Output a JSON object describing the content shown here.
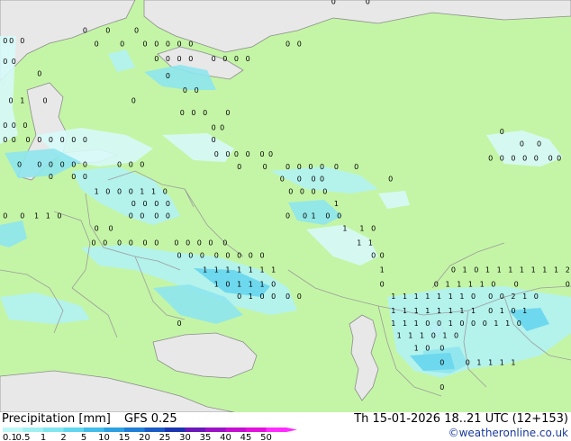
{
  "footer": {
    "title": "Precipitation [mm]",
    "model": "GFS 0.25",
    "valid": "Th 15-01-2026 18..21 UTC (12+153)",
    "credit": "©weatheronline.co.uk"
  },
  "legend": {
    "values": [
      "0.1",
      "0.5",
      "1",
      "2",
      "5",
      "10",
      "15",
      "20",
      "25",
      "30",
      "35",
      "40",
      "45",
      "50"
    ],
    "colors": [
      "#bdf7f7",
      "#9ef0f2",
      "#7fe6ef",
      "#5fd6ee",
      "#42bdea",
      "#2da0e2",
      "#1f7fd6",
      "#1a5ac4",
      "#1b34b0",
      "#6a18b8",
      "#9a12c4",
      "#c40fd0",
      "#e211dc",
      "#ff2bff"
    ]
  },
  "map": {
    "land_color": "#c4f5a6",
    "sea_color": "#e8e8e8",
    "border_color": "#8c8c8c",
    "precip_colors": [
      "#d7fafa",
      "#b2f2f4",
      "#8ee6ee"
    ],
    "markers": [
      {
        "x": 0.005,
        "y": 0.105,
        "t": "0"
      },
      {
        "x": 0.016,
        "y": 0.105,
        "t": "0"
      },
      {
        "x": 0.035,
        "y": 0.105,
        "t": "0"
      },
      {
        "x": 0.005,
        "y": 0.155,
        "t": "0"
      },
      {
        "x": 0.02,
        "y": 0.155,
        "t": "0"
      },
      {
        "x": 0.145,
        "y": 0.08,
        "t": "0"
      },
      {
        "x": 0.185,
        "y": 0.08,
        "t": "0"
      },
      {
        "x": 0.235,
        "y": 0.08,
        "t": "0"
      },
      {
        "x": 0.165,
        "y": 0.112,
        "t": "0"
      },
      {
        "x": 0.21,
        "y": 0.112,
        "t": "0"
      },
      {
        "x": 0.25,
        "y": 0.112,
        "t": "0"
      },
      {
        "x": 0.27,
        "y": 0.112,
        "t": "0"
      },
      {
        "x": 0.29,
        "y": 0.112,
        "t": "0"
      },
      {
        "x": 0.31,
        "y": 0.112,
        "t": "0"
      },
      {
        "x": 0.33,
        "y": 0.112,
        "t": "0"
      },
      {
        "x": 0.27,
        "y": 0.148,
        "t": "0"
      },
      {
        "x": 0.29,
        "y": 0.148,
        "t": "0"
      },
      {
        "x": 0.31,
        "y": 0.148,
        "t": "0"
      },
      {
        "x": 0.33,
        "y": 0.148,
        "t": "0"
      },
      {
        "x": 0.37,
        "y": 0.148,
        "t": "0"
      },
      {
        "x": 0.39,
        "y": 0.148,
        "t": "0"
      },
      {
        "x": 0.41,
        "y": 0.148,
        "t": "0"
      },
      {
        "x": 0.43,
        "y": 0.148,
        "t": "0"
      },
      {
        "x": 0.5,
        "y": 0.112,
        "t": "0"
      },
      {
        "x": 0.52,
        "y": 0.112,
        "t": "0"
      },
      {
        "x": 0.065,
        "y": 0.185,
        "t": "0"
      },
      {
        "x": 0.29,
        "y": 0.19,
        "t": "0"
      },
      {
        "x": 0.015,
        "y": 0.25,
        "t": "0"
      },
      {
        "x": 0.035,
        "y": 0.25,
        "t": "1"
      },
      {
        "x": 0.075,
        "y": 0.25,
        "t": "0"
      },
      {
        "x": 0.23,
        "y": 0.25,
        "t": "0"
      },
      {
        "x": 0.32,
        "y": 0.225,
        "t": "0"
      },
      {
        "x": 0.34,
        "y": 0.225,
        "t": "0"
      },
      {
        "x": 0.315,
        "y": 0.28,
        "t": "0"
      },
      {
        "x": 0.335,
        "y": 0.28,
        "t": "0"
      },
      {
        "x": 0.355,
        "y": 0.28,
        "t": "0"
      },
      {
        "x": 0.395,
        "y": 0.28,
        "t": "0"
      },
      {
        "x": 0.005,
        "y": 0.31,
        "t": "0"
      },
      {
        "x": 0.02,
        "y": 0.31,
        "t": "0"
      },
      {
        "x": 0.04,
        "y": 0.31,
        "t": "0"
      },
      {
        "x": 0.005,
        "y": 0.345,
        "t": "0"
      },
      {
        "x": 0.02,
        "y": 0.345,
        "t": "0"
      },
      {
        "x": 0.045,
        "y": 0.345,
        "t": "0"
      },
      {
        "x": 0.065,
        "y": 0.345,
        "t": "0"
      },
      {
        "x": 0.085,
        "y": 0.345,
        "t": "0"
      },
      {
        "x": 0.105,
        "y": 0.345,
        "t": "0"
      },
      {
        "x": 0.125,
        "y": 0.345,
        "t": "0"
      },
      {
        "x": 0.145,
        "y": 0.345,
        "t": "0"
      },
      {
        "x": 0.37,
        "y": 0.315,
        "t": "0"
      },
      {
        "x": 0.385,
        "y": 0.315,
        "t": "0"
      },
      {
        "x": 0.37,
        "y": 0.345,
        "t": "0"
      },
      {
        "x": 0.375,
        "y": 0.38,
        "t": "0"
      },
      {
        "x": 0.395,
        "y": 0.38,
        "t": "0"
      },
      {
        "x": 0.41,
        "y": 0.38,
        "t": "0"
      },
      {
        "x": 0.43,
        "y": 0.38,
        "t": "0"
      },
      {
        "x": 0.455,
        "y": 0.38,
        "t": "0"
      },
      {
        "x": 0.47,
        "y": 0.38,
        "t": "0"
      },
      {
        "x": 0.415,
        "y": 0.41,
        "t": "0"
      },
      {
        "x": 0.46,
        "y": 0.41,
        "t": "0"
      },
      {
        "x": 0.5,
        "y": 0.41,
        "t": "0"
      },
      {
        "x": 0.52,
        "y": 0.41,
        "t": "0"
      },
      {
        "x": 0.54,
        "y": 0.41,
        "t": "0"
      },
      {
        "x": 0.56,
        "y": 0.41,
        "t": "0"
      },
      {
        "x": 0.585,
        "y": 0.41,
        "t": "0"
      },
      {
        "x": 0.49,
        "y": 0.44,
        "t": "0"
      },
      {
        "x": 0.52,
        "y": 0.44,
        "t": "0"
      },
      {
        "x": 0.545,
        "y": 0.44,
        "t": "0"
      },
      {
        "x": 0.56,
        "y": 0.44,
        "t": "0"
      },
      {
        "x": 0.62,
        "y": 0.41,
        "t": "0"
      },
      {
        "x": 0.68,
        "y": 0.44,
        "t": "0"
      },
      {
        "x": 0.03,
        "y": 0.405,
        "t": "0"
      },
      {
        "x": 0.065,
        "y": 0.405,
        "t": "0"
      },
      {
        "x": 0.085,
        "y": 0.405,
        "t": "0"
      },
      {
        "x": 0.105,
        "y": 0.405,
        "t": "0"
      },
      {
        "x": 0.125,
        "y": 0.405,
        "t": "0"
      },
      {
        "x": 0.145,
        "y": 0.405,
        "t": "0"
      },
      {
        "x": 0.205,
        "y": 0.405,
        "t": "0"
      },
      {
        "x": 0.225,
        "y": 0.405,
        "t": "0"
      },
      {
        "x": 0.245,
        "y": 0.405,
        "t": "0"
      },
      {
        "x": 0.085,
        "y": 0.435,
        "t": "0"
      },
      {
        "x": 0.125,
        "y": 0.435,
        "t": "0"
      },
      {
        "x": 0.145,
        "y": 0.435,
        "t": "0"
      },
      {
        "x": 0.165,
        "y": 0.47,
        "t": "1"
      },
      {
        "x": 0.185,
        "y": 0.47,
        "t": "0"
      },
      {
        "x": 0.205,
        "y": 0.47,
        "t": "0"
      },
      {
        "x": 0.225,
        "y": 0.47,
        "t": "0"
      },
      {
        "x": 0.245,
        "y": 0.47,
        "t": "1"
      },
      {
        "x": 0.265,
        "y": 0.47,
        "t": "1"
      },
      {
        "x": 0.285,
        "y": 0.47,
        "t": "0"
      },
      {
        "x": 0.23,
        "y": 0.5,
        "t": "0"
      },
      {
        "x": 0.25,
        "y": 0.5,
        "t": "0"
      },
      {
        "x": 0.27,
        "y": 0.5,
        "t": "0"
      },
      {
        "x": 0.29,
        "y": 0.5,
        "t": "0"
      },
      {
        "x": 0.505,
        "y": 0.47,
        "t": "0"
      },
      {
        "x": 0.525,
        "y": 0.47,
        "t": "0"
      },
      {
        "x": 0.545,
        "y": 0.47,
        "t": "0"
      },
      {
        "x": 0.565,
        "y": 0.47,
        "t": "0"
      },
      {
        "x": 0.585,
        "y": 0.5,
        "t": "1"
      },
      {
        "x": 0.5,
        "y": 0.53,
        "t": "0"
      },
      {
        "x": 0.53,
        "y": 0.53,
        "t": "0"
      },
      {
        "x": 0.545,
        "y": 0.53,
        "t": "1"
      },
      {
        "x": 0.57,
        "y": 0.53,
        "t": "0"
      },
      {
        "x": 0.59,
        "y": 0.53,
        "t": "0"
      },
      {
        "x": 0.005,
        "y": 0.53,
        "t": "0"
      },
      {
        "x": 0.035,
        "y": 0.53,
        "t": "0"
      },
      {
        "x": 0.06,
        "y": 0.53,
        "t": "1"
      },
      {
        "x": 0.08,
        "y": 0.53,
        "t": "1"
      },
      {
        "x": 0.1,
        "y": 0.53,
        "t": "0"
      },
      {
        "x": 0.225,
        "y": 0.53,
        "t": "0"
      },
      {
        "x": 0.245,
        "y": 0.53,
        "t": "0"
      },
      {
        "x": 0.27,
        "y": 0.53,
        "t": "0"
      },
      {
        "x": 0.29,
        "y": 0.53,
        "t": "0"
      },
      {
        "x": 0.6,
        "y": 0.56,
        "t": "1"
      },
      {
        "x": 0.63,
        "y": 0.56,
        "t": "1"
      },
      {
        "x": 0.65,
        "y": 0.56,
        "t": "0"
      },
      {
        "x": 0.165,
        "y": 0.56,
        "t": "0"
      },
      {
        "x": 0.19,
        "y": 0.56,
        "t": "0"
      },
      {
        "x": 0.625,
        "y": 0.595,
        "t": "1"
      },
      {
        "x": 0.645,
        "y": 0.595,
        "t": "1"
      },
      {
        "x": 0.16,
        "y": 0.595,
        "t": "0"
      },
      {
        "x": 0.18,
        "y": 0.595,
        "t": "0"
      },
      {
        "x": 0.205,
        "y": 0.595,
        "t": "0"
      },
      {
        "x": 0.225,
        "y": 0.595,
        "t": "0"
      },
      {
        "x": 0.25,
        "y": 0.595,
        "t": "0"
      },
      {
        "x": 0.27,
        "y": 0.595,
        "t": "0"
      },
      {
        "x": 0.305,
        "y": 0.595,
        "t": "0"
      },
      {
        "x": 0.325,
        "y": 0.595,
        "t": "0"
      },
      {
        "x": 0.345,
        "y": 0.595,
        "t": "0"
      },
      {
        "x": 0.365,
        "y": 0.595,
        "t": "0"
      },
      {
        "x": 0.39,
        "y": 0.595,
        "t": "0"
      },
      {
        "x": 0.31,
        "y": 0.625,
        "t": "0"
      },
      {
        "x": 0.33,
        "y": 0.625,
        "t": "0"
      },
      {
        "x": 0.35,
        "y": 0.625,
        "t": "0"
      },
      {
        "x": 0.375,
        "y": 0.625,
        "t": "0"
      },
      {
        "x": 0.395,
        "y": 0.625,
        "t": "0"
      },
      {
        "x": 0.415,
        "y": 0.625,
        "t": "0"
      },
      {
        "x": 0.435,
        "y": 0.625,
        "t": "0"
      },
      {
        "x": 0.455,
        "y": 0.625,
        "t": "0"
      },
      {
        "x": 0.65,
        "y": 0.625,
        "t": "0"
      },
      {
        "x": 0.665,
        "y": 0.625,
        "t": "0"
      },
      {
        "x": 0.355,
        "y": 0.66,
        "t": "1"
      },
      {
        "x": 0.375,
        "y": 0.66,
        "t": "1"
      },
      {
        "x": 0.395,
        "y": 0.66,
        "t": "1"
      },
      {
        "x": 0.415,
        "y": 0.66,
        "t": "1"
      },
      {
        "x": 0.435,
        "y": 0.66,
        "t": "1"
      },
      {
        "x": 0.455,
        "y": 0.66,
        "t": "1"
      },
      {
        "x": 0.475,
        "y": 0.66,
        "t": "1"
      },
      {
        "x": 0.665,
        "y": 0.66,
        "t": "1"
      },
      {
        "x": 0.79,
        "y": 0.66,
        "t": "0"
      },
      {
        "x": 0.81,
        "y": 0.66,
        "t": "1"
      },
      {
        "x": 0.83,
        "y": 0.66,
        "t": "0"
      },
      {
        "x": 0.85,
        "y": 0.66,
        "t": "1"
      },
      {
        "x": 0.87,
        "y": 0.66,
        "t": "1"
      },
      {
        "x": 0.89,
        "y": 0.66,
        "t": "1"
      },
      {
        "x": 0.91,
        "y": 0.66,
        "t": "1"
      },
      {
        "x": 0.93,
        "y": 0.66,
        "t": "1"
      },
      {
        "x": 0.95,
        "y": 0.66,
        "t": "1"
      },
      {
        "x": 0.97,
        "y": 0.66,
        "t": "1"
      },
      {
        "x": 0.99,
        "y": 0.66,
        "t": "2"
      },
      {
        "x": 0.375,
        "y": 0.695,
        "t": "1"
      },
      {
        "x": 0.395,
        "y": 0.695,
        "t": "0"
      },
      {
        "x": 0.415,
        "y": 0.695,
        "t": "1"
      },
      {
        "x": 0.435,
        "y": 0.695,
        "t": "1"
      },
      {
        "x": 0.455,
        "y": 0.695,
        "t": "1"
      },
      {
        "x": 0.475,
        "y": 0.695,
        "t": "0"
      },
      {
        "x": 0.665,
        "y": 0.695,
        "t": "0"
      },
      {
        "x": 0.76,
        "y": 0.695,
        "t": "0"
      },
      {
        "x": 0.78,
        "y": 0.695,
        "t": "1"
      },
      {
        "x": 0.8,
        "y": 0.695,
        "t": "1"
      },
      {
        "x": 0.82,
        "y": 0.695,
        "t": "1"
      },
      {
        "x": 0.84,
        "y": 0.695,
        "t": "1"
      },
      {
        "x": 0.86,
        "y": 0.695,
        "t": "0"
      },
      {
        "x": 0.9,
        "y": 0.695,
        "t": "0"
      },
      {
        "x": 0.99,
        "y": 0.695,
        "t": "0"
      },
      {
        "x": 0.415,
        "y": 0.725,
        "t": "0"
      },
      {
        "x": 0.435,
        "y": 0.725,
        "t": "1"
      },
      {
        "x": 0.455,
        "y": 0.725,
        "t": "0"
      },
      {
        "x": 0.475,
        "y": 0.725,
        "t": "0"
      },
      {
        "x": 0.5,
        "y": 0.725,
        "t": "0"
      },
      {
        "x": 0.52,
        "y": 0.725,
        "t": "0"
      },
      {
        "x": 0.685,
        "y": 0.725,
        "t": "1"
      },
      {
        "x": 0.705,
        "y": 0.725,
        "t": "1"
      },
      {
        "x": 0.725,
        "y": 0.725,
        "t": "1"
      },
      {
        "x": 0.745,
        "y": 0.725,
        "t": "1"
      },
      {
        "x": 0.765,
        "y": 0.725,
        "t": "1"
      },
      {
        "x": 0.785,
        "y": 0.725,
        "t": "1"
      },
      {
        "x": 0.805,
        "y": 0.725,
        "t": "1"
      },
      {
        "x": 0.825,
        "y": 0.725,
        "t": "0"
      },
      {
        "x": 0.855,
        "y": 0.725,
        "t": "0"
      },
      {
        "x": 0.875,
        "y": 0.725,
        "t": "0"
      },
      {
        "x": 0.895,
        "y": 0.725,
        "t": "2"
      },
      {
        "x": 0.915,
        "y": 0.725,
        "t": "1"
      },
      {
        "x": 0.935,
        "y": 0.725,
        "t": "0"
      },
      {
        "x": 0.685,
        "y": 0.76,
        "t": "1"
      },
      {
        "x": 0.705,
        "y": 0.76,
        "t": "1"
      },
      {
        "x": 0.725,
        "y": 0.76,
        "t": "1"
      },
      {
        "x": 0.745,
        "y": 0.76,
        "t": "1"
      },
      {
        "x": 0.765,
        "y": 0.76,
        "t": "1"
      },
      {
        "x": 0.785,
        "y": 0.76,
        "t": "1"
      },
      {
        "x": 0.805,
        "y": 0.76,
        "t": "1"
      },
      {
        "x": 0.825,
        "y": 0.76,
        "t": "1"
      },
      {
        "x": 0.855,
        "y": 0.76,
        "t": "0"
      },
      {
        "x": 0.875,
        "y": 0.76,
        "t": "1"
      },
      {
        "x": 0.895,
        "y": 0.76,
        "t": "0"
      },
      {
        "x": 0.915,
        "y": 0.76,
        "t": "1"
      },
      {
        "x": 0.685,
        "y": 0.79,
        "t": "1"
      },
      {
        "x": 0.705,
        "y": 0.79,
        "t": "1"
      },
      {
        "x": 0.725,
        "y": 0.79,
        "t": "1"
      },
      {
        "x": 0.745,
        "y": 0.79,
        "t": "0"
      },
      {
        "x": 0.765,
        "y": 0.79,
        "t": "0"
      },
      {
        "x": 0.785,
        "y": 0.79,
        "t": "1"
      },
      {
        "x": 0.805,
        "y": 0.79,
        "t": "0"
      },
      {
        "x": 0.825,
        "y": 0.79,
        "t": "0"
      },
      {
        "x": 0.845,
        "y": 0.79,
        "t": "0"
      },
      {
        "x": 0.865,
        "y": 0.79,
        "t": "1"
      },
      {
        "x": 0.885,
        "y": 0.79,
        "t": "1"
      },
      {
        "x": 0.905,
        "y": 0.79,
        "t": "0"
      },
      {
        "x": 0.31,
        "y": 0.79,
        "t": "0"
      },
      {
        "x": 0.695,
        "y": 0.82,
        "t": "1"
      },
      {
        "x": 0.715,
        "y": 0.82,
        "t": "1"
      },
      {
        "x": 0.735,
        "y": 0.82,
        "t": "1"
      },
      {
        "x": 0.755,
        "y": 0.82,
        "t": "0"
      },
      {
        "x": 0.775,
        "y": 0.82,
        "t": "1"
      },
      {
        "x": 0.795,
        "y": 0.82,
        "t": "0"
      },
      {
        "x": 0.725,
        "y": 0.85,
        "t": "1"
      },
      {
        "x": 0.745,
        "y": 0.85,
        "t": "0"
      },
      {
        "x": 0.77,
        "y": 0.85,
        "t": "0"
      },
      {
        "x": 0.77,
        "y": 0.885,
        "t": "0"
      },
      {
        "x": 0.815,
        "y": 0.885,
        "t": "0"
      },
      {
        "x": 0.835,
        "y": 0.885,
        "t": "1"
      },
      {
        "x": 0.855,
        "y": 0.885,
        "t": "1"
      },
      {
        "x": 0.875,
        "y": 0.885,
        "t": "1"
      },
      {
        "x": 0.895,
        "y": 0.885,
        "t": "1"
      },
      {
        "x": 0.77,
        "y": 0.945,
        "t": "0"
      },
      {
        "x": 0.855,
        "y": 0.39,
        "t": "0"
      },
      {
        "x": 0.875,
        "y": 0.39,
        "t": "0"
      },
      {
        "x": 0.895,
        "y": 0.39,
        "t": "0"
      },
      {
        "x": 0.915,
        "y": 0.39,
        "t": "0"
      },
      {
        "x": 0.935,
        "y": 0.39,
        "t": "0"
      },
      {
        "x": 0.875,
        "y": 0.325,
        "t": "0"
      },
      {
        "x": 0.91,
        "y": 0.355,
        "t": "0"
      },
      {
        "x": 0.94,
        "y": 0.355,
        "t": "0"
      },
      {
        "x": 0.96,
        "y": 0.39,
        "t": "0"
      },
      {
        "x": 0.975,
        "y": 0.39,
        "t": "0"
      },
      {
        "x": 0.58,
        "y": 0.01,
        "t": "0"
      },
      {
        "x": 0.64,
        "y": 0.01,
        "t": "0"
      }
    ]
  }
}
